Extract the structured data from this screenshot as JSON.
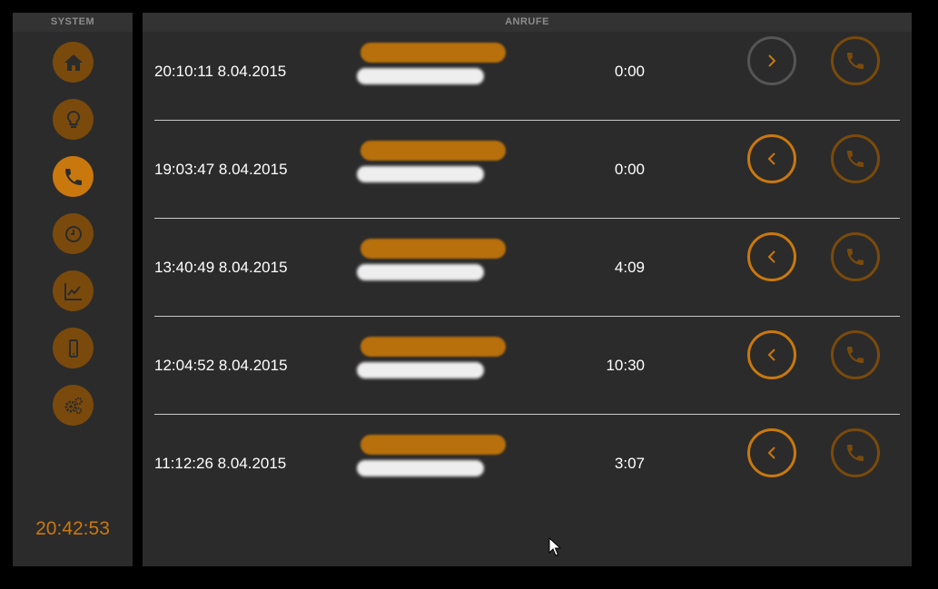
{
  "sidebar": {
    "title": "SYSTEM",
    "items": [
      {
        "icon": "home-icon",
        "name": "home",
        "active": false
      },
      {
        "icon": "lightbulb-icon",
        "name": "lights",
        "active": false
      },
      {
        "icon": "phone-icon",
        "name": "calls",
        "active": true
      },
      {
        "icon": "clock-icon",
        "name": "timer",
        "active": false
      },
      {
        "icon": "chart-icon",
        "name": "statistics",
        "active": false
      },
      {
        "icon": "mobile-icon",
        "name": "mobile",
        "active": false
      },
      {
        "icon": "gears-icon",
        "name": "settings",
        "active": false
      }
    ],
    "clock": "20:42:53"
  },
  "main": {
    "title": "ANRUFE",
    "calls": [
      {
        "datetime": "20:10:11 8.04.2015",
        "duration": "0:00",
        "direction": "outgoing",
        "direction_icon": "chevron-right-icon"
      },
      {
        "datetime": "19:03:47 8.04.2015",
        "duration": "0:00",
        "direction": "incoming",
        "direction_icon": "chevron-left-icon"
      },
      {
        "datetime": "13:40:49 8.04.2015",
        "duration": "4:09",
        "direction": "incoming",
        "direction_icon": "chevron-left-icon"
      },
      {
        "datetime": "12:04:52 8.04.2015",
        "duration": "10:30",
        "direction": "incoming",
        "direction_icon": "chevron-left-icon"
      },
      {
        "datetime": "11:12:26 8.04.2015",
        "duration": "3:07",
        "direction": "incoming",
        "direction_icon": "chevron-left-icon"
      }
    ]
  },
  "colors": {
    "accent": "#c9780e",
    "accent_dim": "#7a4a0c",
    "panel": "#2b2b2b",
    "header": "#333333",
    "background": "#000000",
    "redacted_name": "#b8700c",
    "redacted_sub": "#eeeeee"
  }
}
